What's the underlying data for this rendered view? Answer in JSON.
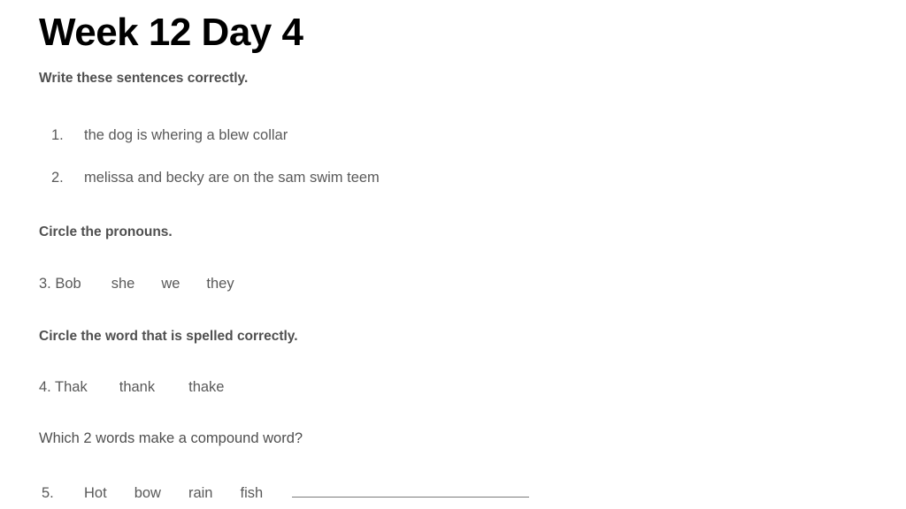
{
  "worksheet": {
    "title": "Week 12 Day 4",
    "sections": [
      {
        "instruction": "Write these sentences correctly.",
        "items": [
          {
            "number": "1.",
            "text": "the dog is whering a blew collar"
          },
          {
            "number": "2.",
            "text": "melissa and becky are on the sam swim teem"
          }
        ]
      },
      {
        "instruction": "Circle the pronouns.",
        "item": {
          "lead": "3. Bob",
          "options": [
            "she",
            "we",
            "they"
          ]
        }
      },
      {
        "instruction": "Circle the word that is spelled correctly.",
        "item": {
          "lead": "4. Thak",
          "options": [
            "thank",
            "thake"
          ]
        }
      },
      {
        "prompt": "Which 2 words make a compound word?",
        "item": {
          "number": "5.",
          "options": [
            "Hot",
            "bow",
            "rain",
            "fish"
          ],
          "answer": ""
        }
      }
    ]
  },
  "colors": {
    "background": "#ffffff",
    "title_text": "#000000",
    "instruction_text": "#4f4f4f",
    "body_text": "#595959",
    "blank_rule": "#7a7a7a"
  }
}
